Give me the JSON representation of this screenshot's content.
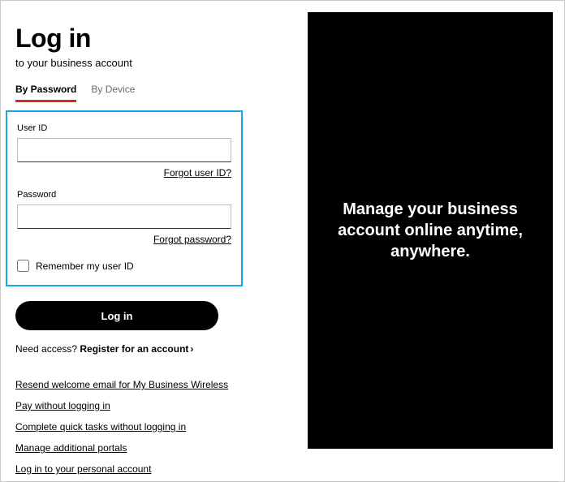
{
  "header": {
    "title": "Log in",
    "subtitle": "to your business account"
  },
  "tabs": {
    "by_password": "By Password",
    "by_device": "By Device"
  },
  "form": {
    "user_id_label": "User ID",
    "user_id_value": "",
    "forgot_user": "Forgot user ID?",
    "password_label": "Password",
    "password_value": "",
    "forgot_password": "Forgot password?",
    "remember_label": "Remember my user ID"
  },
  "actions": {
    "login": "Log in",
    "need_access": "Need access? ",
    "register": "Register for an account",
    "chevron": "›"
  },
  "links": {
    "resend": "Resend welcome email for My Business Wireless",
    "pay": "Pay without logging in",
    "quick": "Complete quick tasks without logging in",
    "portals": "Manage additional portals",
    "personal": "Log in to your personal account"
  },
  "promo": {
    "text": "Manage your business account online anytime, anywhere."
  }
}
